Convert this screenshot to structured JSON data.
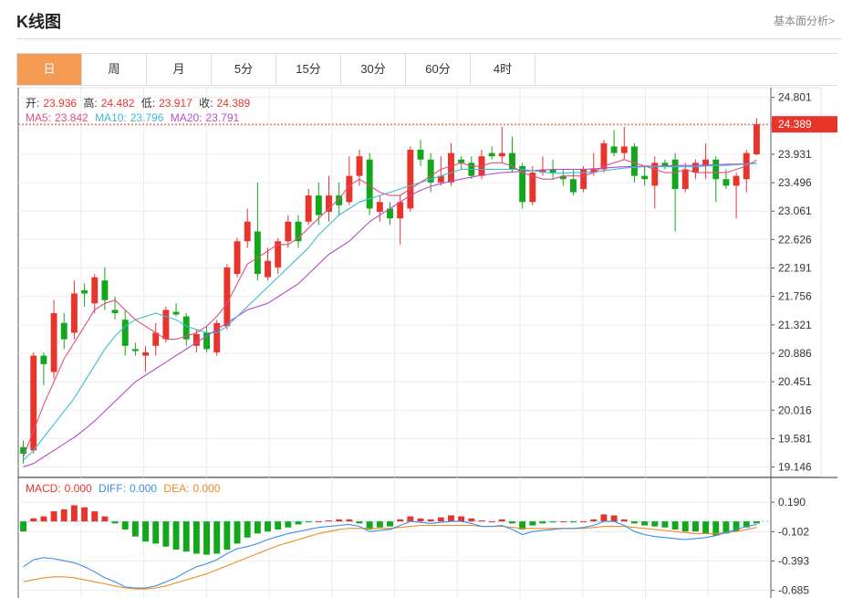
{
  "header": {
    "title": "K线图",
    "more_link": "基本面分析>"
  },
  "tabs": [
    {
      "label": "日",
      "active": true
    },
    {
      "label": "周",
      "active": false
    },
    {
      "label": "月",
      "active": false
    },
    {
      "label": "5分",
      "active": false
    },
    {
      "label": "15分",
      "active": false
    },
    {
      "label": "30分",
      "active": false
    },
    {
      "label": "60分",
      "active": false
    },
    {
      "label": "4时",
      "active": false
    }
  ],
  "ohlc_info": {
    "open_label": "开:",
    "open": "23.936",
    "high_label": "高:",
    "high": "24.482",
    "low_label": "低:",
    "low": "23.917",
    "close_label": "收:",
    "close": "24.389"
  },
  "ma_info": {
    "ma5_label": "MA5:",
    "ma5": "23.842",
    "ma10_label": "MA10:",
    "ma10": "23.796",
    "ma20_label": "MA20:",
    "ma20": "23.791"
  },
  "macd_info": {
    "macd_label": "MACD:",
    "macd": "0.000",
    "diff_label": "DIFF:",
    "diff": "0.000",
    "dea_label": "DEA:",
    "dea": "0.000"
  },
  "colors": {
    "up": "#e8352c",
    "down": "#13a81b",
    "ma5": "#e04f7f",
    "ma10": "#3bbcd4",
    "ma20": "#b64ec9",
    "diff": "#3a8ee6",
    "dea": "#f08a24",
    "grid": "#ececec"
  },
  "chart_data": {
    "type": "candlestick",
    "price_axis": {
      "range": [
        19.0,
        24.95
      ],
      "ticks": [
        "24.801",
        "24.366",
        "23.931",
        "23.496",
        "23.061",
        "22.626",
        "22.191",
        "21.756",
        "21.321",
        "20.886",
        "20.451",
        "20.016",
        "19.581",
        "19.146"
      ]
    },
    "last_price_label": "24.389",
    "macd_axis": {
      "range": [
        -0.76,
        0.3
      ],
      "ticks": [
        "0.190",
        "-0.102",
        "-0.393",
        "-0.685"
      ]
    },
    "candles": [
      [
        19.45,
        19.35,
        19.55,
        19.2
      ],
      [
        19.4,
        20.85,
        20.9,
        19.35
      ],
      [
        20.85,
        20.72,
        20.9,
        20.4
      ],
      [
        20.6,
        21.5,
        21.7,
        20.5
      ],
      [
        21.35,
        21.1,
        21.5,
        20.95
      ],
      [
        21.2,
        21.8,
        22.0,
        21.1
      ],
      [
        21.85,
        21.8,
        21.95,
        21.6
      ],
      [
        21.65,
        22.05,
        22.1,
        21.5
      ],
      [
        22.0,
        21.7,
        22.2,
        21.55
      ],
      [
        21.55,
        21.5,
        21.75,
        21.4
      ],
      [
        21.4,
        21.0,
        21.55,
        20.85
      ],
      [
        20.95,
        20.92,
        21.05,
        20.85
      ],
      [
        20.85,
        20.9,
        21.0,
        20.6
      ],
      [
        21.0,
        21.2,
        21.35,
        20.85
      ],
      [
        21.1,
        21.55,
        21.6,
        21.05
      ],
      [
        21.52,
        21.48,
        21.65,
        21.45
      ],
      [
        21.45,
        21.1,
        21.5,
        21.0
      ],
      [
        21.0,
        21.18,
        21.25,
        20.9
      ],
      [
        21.2,
        20.95,
        21.3,
        20.9
      ],
      [
        20.9,
        21.35,
        21.4,
        20.85
      ],
      [
        21.3,
        22.2,
        22.25,
        21.25
      ],
      [
        22.1,
        22.6,
        22.65,
        22.05
      ],
      [
        22.6,
        22.9,
        23.1,
        22.5
      ],
      [
        22.75,
        22.1,
        23.5,
        22.0
      ],
      [
        22.05,
        22.3,
        22.5,
        22.0
      ],
      [
        22.2,
        22.6,
        22.65,
        22.1
      ],
      [
        22.6,
        22.9,
        23.0,
        22.5
      ],
      [
        22.9,
        22.6,
        23.0,
        22.5
      ],
      [
        22.9,
        23.3,
        23.4,
        22.85
      ],
      [
        23.3,
        23.0,
        23.5,
        22.85
      ],
      [
        23.05,
        23.3,
        23.6,
        22.9
      ],
      [
        23.3,
        23.15,
        23.5,
        23.0
      ],
      [
        23.2,
        23.6,
        23.9,
        23.15
      ],
      [
        23.6,
        23.9,
        24.0,
        23.45
      ],
      [
        23.85,
        23.1,
        23.95,
        23.0
      ],
      [
        23.05,
        23.2,
        23.3,
        22.9
      ],
      [
        23.1,
        22.95,
        23.2,
        22.85
      ],
      [
        22.95,
        23.2,
        23.3,
        22.55
      ],
      [
        23.1,
        24.0,
        24.05,
        23.05
      ],
      [
        24.0,
        23.85,
        24.15,
        23.75
      ],
      [
        23.85,
        23.5,
        23.95,
        23.35
      ],
      [
        23.5,
        23.6,
        23.9,
        23.45
      ],
      [
        23.5,
        23.95,
        24.1,
        23.45
      ],
      [
        23.85,
        23.8,
        23.9,
        23.7
      ],
      [
        23.8,
        23.6,
        23.9,
        23.55
      ],
      [
        23.6,
        23.9,
        24.0,
        23.55
      ],
      [
        23.95,
        23.9,
        24.05,
        23.85
      ],
      [
        23.9,
        23.95,
        24.35,
        23.8
      ],
      [
        23.95,
        23.7,
        24.2,
        23.65
      ],
      [
        23.75,
        23.2,
        23.8,
        23.1
      ],
      [
        23.2,
        23.65,
        23.75,
        23.15
      ],
      [
        23.65,
        23.7,
        23.9,
        23.6
      ],
      [
        23.7,
        23.65,
        23.85,
        23.55
      ],
      [
        23.6,
        23.55,
        23.7,
        23.45
      ],
      [
        23.55,
        23.35,
        23.7,
        23.3
      ],
      [
        23.4,
        23.7,
        23.75,
        23.35
      ],
      [
        23.65,
        23.7,
        23.95,
        23.6
      ],
      [
        23.7,
        24.1,
        24.15,
        23.65
      ],
      [
        24.05,
        23.95,
        24.3,
        23.9
      ],
      [
        23.95,
        24.05,
        24.35,
        23.85
      ],
      [
        24.05,
        23.6,
        24.1,
        23.5
      ],
      [
        23.6,
        23.55,
        23.75,
        23.45
      ],
      [
        23.45,
        23.8,
        23.9,
        23.1
      ],
      [
        23.8,
        23.75,
        23.85,
        23.7
      ],
      [
        23.85,
        23.4,
        23.95,
        22.75
      ],
      [
        23.4,
        23.7,
        23.8,
        23.35
      ],
      [
        23.65,
        23.8,
        23.85,
        23.55
      ],
      [
        23.75,
        23.85,
        24.1,
        23.55
      ],
      [
        23.85,
        23.55,
        23.9,
        23.2
      ],
      [
        23.55,
        23.45,
        23.7,
        23.4
      ],
      [
        23.45,
        23.6,
        23.65,
        22.95
      ],
      [
        23.55,
        23.95,
        24.0,
        23.35
      ],
      [
        23.93,
        24.389,
        24.482,
        23.917
      ]
    ],
    "ma5": [
      19.3,
      19.7,
      20.1,
      20.45,
      20.8,
      21.05,
      21.3,
      21.55,
      21.65,
      21.7,
      21.55,
      21.4,
      21.3,
      21.2,
      21.1,
      21.1,
      21.15,
      21.2,
      21.3,
      21.45,
      21.65,
      21.95,
      22.25,
      22.35,
      22.45,
      22.55,
      22.55,
      22.65,
      22.8,
      22.95,
      23.1,
      23.25,
      23.45,
      23.55,
      23.45,
      23.35,
      23.3,
      23.3,
      23.4,
      23.5,
      23.6,
      23.7,
      23.75,
      23.8,
      23.75,
      23.75,
      23.8,
      23.8,
      23.75,
      23.65,
      23.6,
      23.55,
      23.55,
      23.6,
      23.6,
      23.6,
      23.65,
      23.75,
      23.8,
      23.85,
      23.8,
      23.75,
      23.7,
      23.65,
      23.65,
      23.7,
      23.65,
      23.65,
      23.65,
      23.65,
      23.7,
      23.75,
      23.842
    ],
    "ma10": [
      19.25,
      19.4,
      19.6,
      19.8,
      20.0,
      20.2,
      20.45,
      20.7,
      20.95,
      21.15,
      21.3,
      21.4,
      21.45,
      21.5,
      21.45,
      21.4,
      21.3,
      21.25,
      21.2,
      21.2,
      21.3,
      21.45,
      21.6,
      21.75,
      21.9,
      22.05,
      22.2,
      22.35,
      22.5,
      22.7,
      22.85,
      23.0,
      23.1,
      23.2,
      23.25,
      23.3,
      23.35,
      23.4,
      23.45,
      23.5,
      23.55,
      23.6,
      23.65,
      23.7,
      23.7,
      23.7,
      23.7,
      23.7,
      23.7,
      23.7,
      23.68,
      23.66,
      23.64,
      23.64,
      23.65,
      23.65,
      23.66,
      23.68,
      23.7,
      23.72,
      23.73,
      23.74,
      23.74,
      23.74,
      23.74,
      23.74,
      23.74,
      23.75,
      23.76,
      23.76,
      23.77,
      23.78,
      23.796
    ],
    "ma20": [
      19.15,
      19.2,
      19.3,
      19.4,
      19.5,
      19.6,
      19.72,
      19.85,
      20.0,
      20.15,
      20.3,
      20.45,
      20.55,
      20.65,
      20.75,
      20.85,
      20.95,
      21.05,
      21.15,
      21.25,
      21.35,
      21.45,
      21.55,
      21.6,
      21.65,
      21.75,
      21.85,
      21.95,
      22.1,
      22.25,
      22.4,
      22.5,
      22.6,
      22.75,
      22.9,
      23.0,
      23.1,
      23.2,
      23.3,
      23.38,
      23.44,
      23.48,
      23.52,
      23.55,
      23.58,
      23.61,
      23.63,
      23.65,
      23.66,
      23.67,
      23.68,
      23.69,
      23.7,
      23.7,
      23.7,
      23.7,
      23.71,
      23.72,
      23.73,
      23.74,
      23.74,
      23.75,
      23.75,
      23.75,
      23.76,
      23.76,
      23.76,
      23.77,
      23.77,
      23.78,
      23.78,
      23.785,
      23.791
    ],
    "macd_hist": [
      -0.1,
      0.03,
      0.05,
      0.1,
      0.12,
      0.16,
      0.14,
      0.1,
      0.05,
      -0.02,
      -0.08,
      -0.15,
      -0.2,
      -0.22,
      -0.25,
      -0.28,
      -0.3,
      -0.32,
      -0.33,
      -0.32,
      -0.28,
      -0.22,
      -0.16,
      -0.12,
      -0.1,
      -0.08,
      -0.06,
      -0.03,
      -0.01,
      0.0,
      0.01,
      0.02,
      0.02,
      -0.02,
      -0.08,
      -0.06,
      -0.05,
      0.02,
      0.05,
      0.03,
      0.02,
      0.04,
      0.06,
      0.05,
      0.03,
      0.01,
      0.0,
      0.02,
      -0.02,
      -0.08,
      -0.04,
      -0.02,
      -0.01,
      0.0,
      -0.01,
      0.0,
      0.02,
      0.07,
      0.06,
      0.02,
      -0.02,
      -0.04,
      -0.05,
      -0.06,
      -0.08,
      -0.1,
      -0.1,
      -0.12,
      -0.14,
      -0.12,
      -0.1,
      -0.06,
      -0.02
    ],
    "diff": [
      -0.45,
      -0.38,
      -0.36,
      -0.37,
      -0.39,
      -0.41,
      -0.45,
      -0.5,
      -0.56,
      -0.6,
      -0.65,
      -0.66,
      -0.66,
      -0.64,
      -0.6,
      -0.56,
      -0.5,
      -0.45,
      -0.42,
      -0.38,
      -0.32,
      -0.27,
      -0.25,
      -0.22,
      -0.18,
      -0.15,
      -0.12,
      -0.1,
      -0.08,
      -0.06,
      -0.05,
      -0.04,
      -0.03,
      -0.05,
      -0.1,
      -0.09,
      -0.08,
      -0.04,
      0.0,
      -0.01,
      -0.02,
      -0.01,
      0.0,
      0.0,
      -0.02,
      -0.05,
      -0.05,
      -0.04,
      -0.08,
      -0.13,
      -0.1,
      -0.09,
      -0.08,
      -0.07,
      -0.07,
      -0.06,
      -0.04,
      0.0,
      0.0,
      -0.04,
      -0.1,
      -0.13,
      -0.15,
      -0.16,
      -0.17,
      -0.18,
      -0.17,
      -0.16,
      -0.14,
      -0.11,
      -0.08,
      -0.05,
      -0.03
    ],
    "dea": [
      -0.6,
      -0.58,
      -0.56,
      -0.55,
      -0.55,
      -0.56,
      -0.58,
      -0.6,
      -0.62,
      -0.64,
      -0.66,
      -0.67,
      -0.67,
      -0.66,
      -0.64,
      -0.61,
      -0.58,
      -0.55,
      -0.52,
      -0.48,
      -0.44,
      -0.4,
      -0.36,
      -0.32,
      -0.28,
      -0.24,
      -0.21,
      -0.18,
      -0.15,
      -0.12,
      -0.1,
      -0.08,
      -0.07,
      -0.07,
      -0.07,
      -0.07,
      -0.07,
      -0.06,
      -0.05,
      -0.04,
      -0.04,
      -0.04,
      -0.04,
      -0.04,
      -0.04,
      -0.05,
      -0.05,
      -0.05,
      -0.06,
      -0.07,
      -0.07,
      -0.07,
      -0.07,
      -0.07,
      -0.07,
      -0.07,
      -0.06,
      -0.05,
      -0.05,
      -0.05,
      -0.06,
      -0.07,
      -0.08,
      -0.09,
      -0.1,
      -0.11,
      -0.12,
      -0.12,
      -0.12,
      -0.11,
      -0.1,
      -0.08,
      -0.06
    ]
  }
}
